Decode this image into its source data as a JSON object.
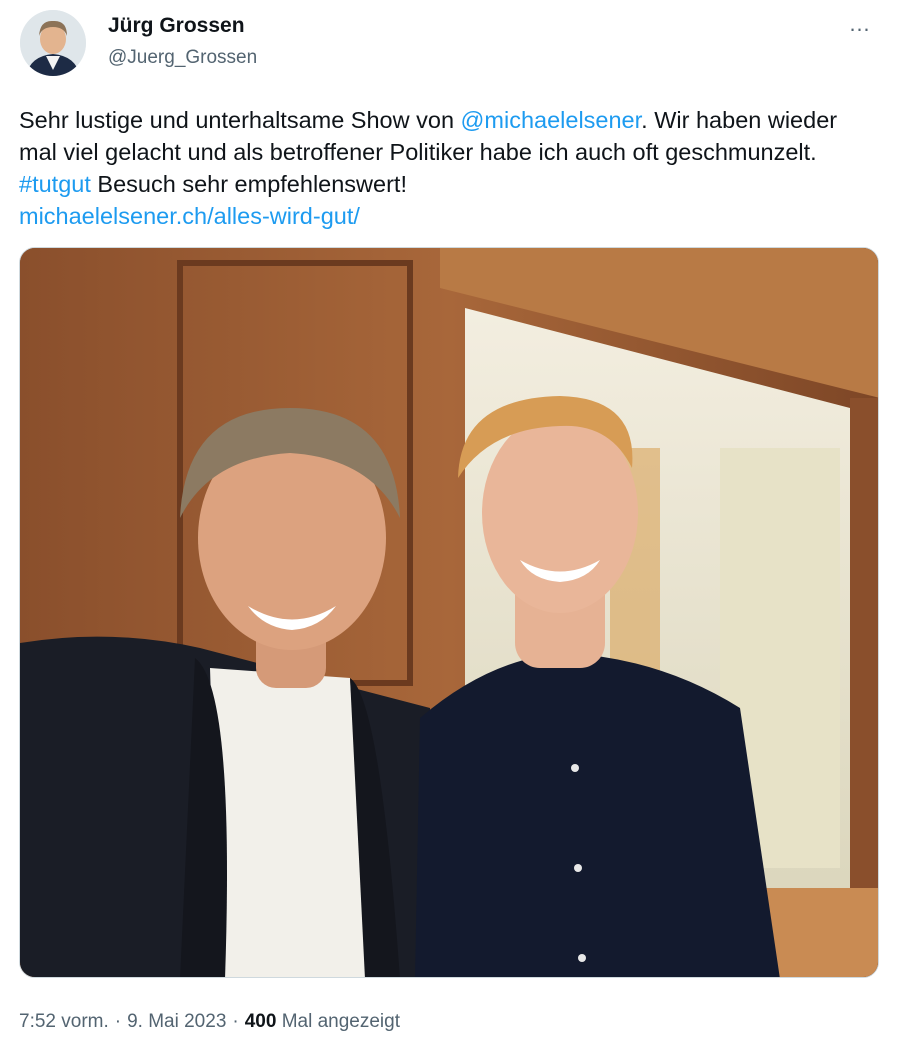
{
  "author": {
    "name": "Jürg Grossen",
    "handle": "@Juerg_Grossen"
  },
  "more_icon": "…",
  "tweet": {
    "text_1": "Sehr lustige und unterhaltsame Show von ",
    "mention": "@michaelelsener",
    "text_2": ". Wir haben wieder mal viel gelacht und als betroffener Politiker habe ich auch oft geschmunzelt. ",
    "hashtag": "#tutgut",
    "text_3": " Besuch sehr empfehlenswert!",
    "link": "michaelelsener.ch/alles-wird-gut/"
  },
  "meta": {
    "time": "7:52 vorm.",
    "separator": "·",
    "date": "9. Mai 2023",
    "views_count": "400",
    "views_label": "Mal angezeigt"
  },
  "colors": {
    "link": "#1d9bf0",
    "text": "#0f1419",
    "secondary": "#536471"
  }
}
